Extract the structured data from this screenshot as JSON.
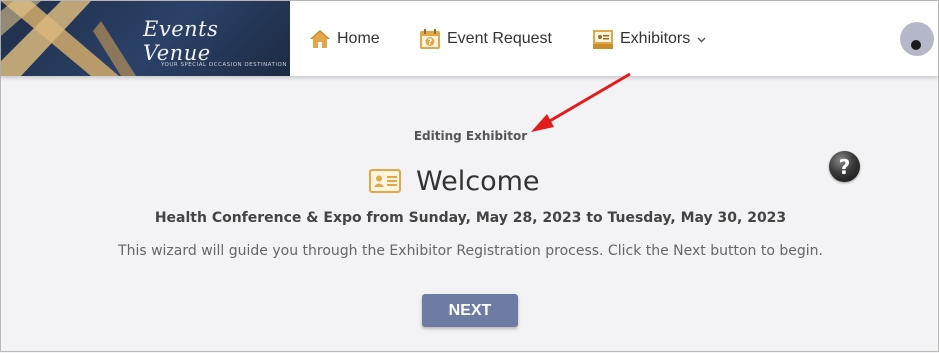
{
  "logo": {
    "script_text": "Events Venue",
    "tagline": "YOUR SPECIAL OCCASION DESTINATION"
  },
  "nav": {
    "home": {
      "label": "Home",
      "icon": "home-icon"
    },
    "event_request": {
      "label": "Event Request",
      "icon": "calendar-question-icon"
    },
    "exhibitors": {
      "label": "Exhibitors",
      "icon": "exhibitor-booth-icon"
    }
  },
  "main": {
    "editing_label": "Editing Exhibitor",
    "title": "Welcome",
    "help_symbol": "?",
    "event_line": "Health Conference & Expo from Sunday, May 28, 2023 to Tuesday, May 30, 2023",
    "guide_text": "This wizard will guide you through the Exhibitor Registration process. Click the Next button to begin.",
    "next_label": "NEXT"
  },
  "colors": {
    "accent_icon": "#e0a84a",
    "button": "#6e7ba3",
    "annotation_arrow": "#e31b1b"
  }
}
